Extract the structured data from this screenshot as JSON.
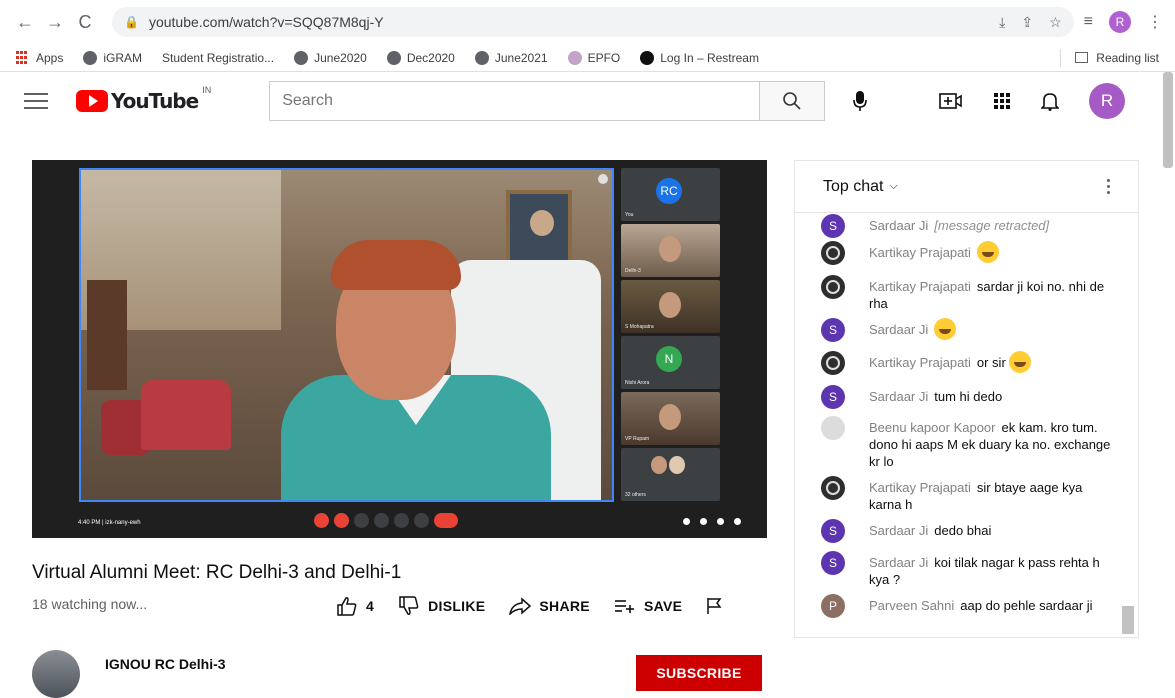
{
  "browser": {
    "url": "youtube.com/watch?v=SQQ87M8qj-Y",
    "profile_initial": "R",
    "bookmarks": [
      "Apps",
      "iGRAM",
      "Student Registratio...",
      "June2020",
      "Dec2020",
      "June2021",
      "EPFO",
      "Log In – Restream"
    ],
    "reading_list": "Reading list"
  },
  "header": {
    "logo_text": "YouTube",
    "country": "IN",
    "search_placeholder": "Search",
    "avatar_initial": "R"
  },
  "player": {
    "tiles": [
      {
        "label": "You",
        "avatar": "RC",
        "avatar_color": "#1a73e8"
      },
      {
        "label": "Delhi-3",
        "avatar": "",
        "avatar_color": ""
      },
      {
        "label": "S Mohapatra",
        "avatar": "",
        "avatar_color": ""
      },
      {
        "label": "Nishi Arora",
        "avatar": "N",
        "avatar_color": "#34a853"
      },
      {
        "label": "VP Rupam",
        "avatar": "",
        "avatar_color": ""
      },
      {
        "label": "32 others",
        "avatar": "",
        "avatar_color": ""
      }
    ],
    "meet_time": "4:40 PM | izk-nany-ewh"
  },
  "video": {
    "title": "Virtual Alumni Meet: RC Delhi-3 and Delhi-1",
    "watching": "18 watching now...",
    "like_count": "4",
    "dislike_label": "DISLIKE",
    "share_label": "SHARE",
    "save_label": "SAVE"
  },
  "channel": {
    "name": "IGNOU RC Delhi-3",
    "subscribe_label": "SUBSCRIBE"
  },
  "chat": {
    "header": "Top chat",
    "messages": [
      {
        "author": "Sardaar Ji",
        "text": "[message retracted]",
        "avatar": "S"
      },
      {
        "author": "Kartikay Prajapati",
        "text": "",
        "avatar": ""
      },
      {
        "author": "Kartikay Prajapati",
        "text": "sardar ji koi no. nhi de rha",
        "avatar": ""
      },
      {
        "author": "Sardaar Ji",
        "text": "",
        "avatar": "S"
      },
      {
        "author": "Kartikay Prajapati",
        "text": "or sir",
        "avatar": ""
      },
      {
        "author": "Sardaar Ji",
        "text": "tum hi dedo",
        "avatar": "S"
      },
      {
        "author": "Beenu kapoor Kapoor",
        "text": "ek kam. kro tum. dono hi aaps M ek duary ka no. exchange kr lo",
        "avatar": ""
      },
      {
        "author": "Kartikay Prajapati",
        "text": "sir btaye aage kya karna h",
        "avatar": ""
      },
      {
        "author": "Sardaar Ji",
        "text": "dedo bhai",
        "avatar": "S"
      },
      {
        "author": "Sardaar Ji",
        "text": "koi tilak nagar k pass rehta h kya ?",
        "avatar": "S"
      },
      {
        "author": "Parveen Sahni",
        "text": "aap do pehle sardaar ji",
        "avatar": "P"
      }
    ]
  }
}
